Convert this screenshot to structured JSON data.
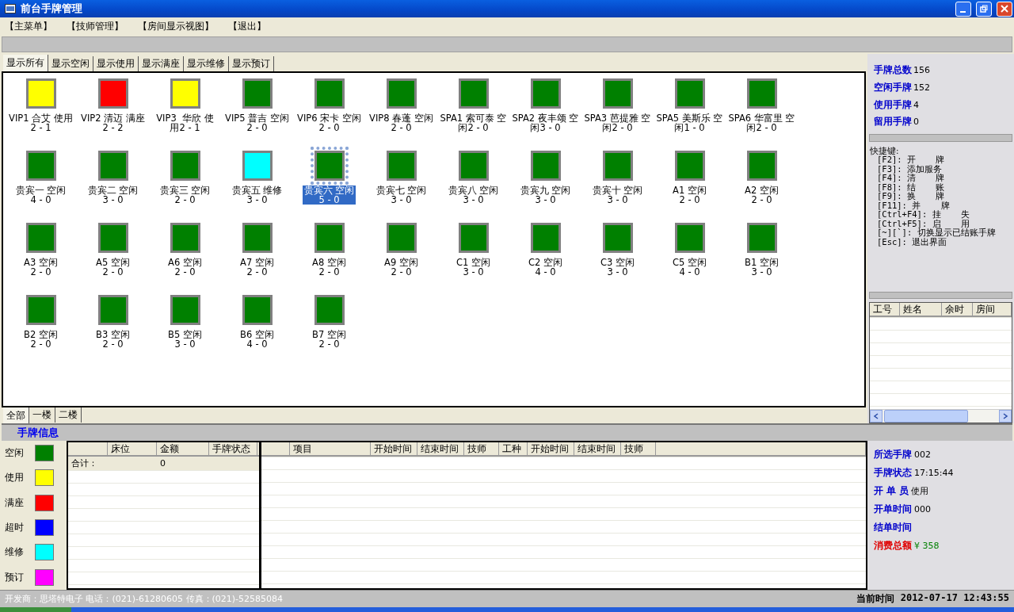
{
  "window": {
    "title": "前台手牌管理"
  },
  "menu": [
    "【主菜单】",
    "【技师管理】",
    "【房间显示视图】",
    "【退出】"
  ],
  "filter_tabs": [
    {
      "label": "显示所有",
      "selected": true
    },
    {
      "label": "显示空闲",
      "selected": false
    },
    {
      "label": "显示使用",
      "selected": false
    },
    {
      "label": "显示满座",
      "selected": false
    },
    {
      "label": "显示维修",
      "selected": false
    },
    {
      "label": "显示预订",
      "selected": false
    }
  ],
  "rooms": [
    {
      "line1": "VIP1 合艾 使用",
      "line2": "2 - 1",
      "color": "#ffff00",
      "selected": false
    },
    {
      "line1": "VIP2 清迈 满座",
      "line2": "2 - 2",
      "color": "#ff0000",
      "selected": false
    },
    {
      "line1": "VIP3  华欣 使",
      "line2": "用2 - 1",
      "color": "#ffff00",
      "selected": false
    },
    {
      "line1": "VIP5 普吉 空闲",
      "line2": "2 - 0",
      "color": "#008000",
      "selected": false
    },
    {
      "line1": "VIP6 宋卡 空闲",
      "line2": "2 - 0",
      "color": "#008000",
      "selected": false
    },
    {
      "line1": "VIP8 春蓬 空闲",
      "line2": "2 - 0",
      "color": "#008000",
      "selected": false
    },
    {
      "line1": "SPA1 索可泰 空",
      "line2": "闲2 - 0",
      "color": "#008000",
      "selected": false
    },
    {
      "line1": "SPA2 夜丰颂 空",
      "line2": "闲3 - 0",
      "color": "#008000",
      "selected": false
    },
    {
      "line1": "SPA3 芭提雅 空",
      "line2": "闲2 - 0",
      "color": "#008000",
      "selected": false
    },
    {
      "line1": "SPA5 美斯乐 空",
      "line2": "闲1 - 0",
      "color": "#008000",
      "selected": false
    },
    {
      "line1": "SPA6 华富里 空",
      "line2": "闲2 - 0",
      "color": "#008000",
      "selected": false
    },
    {
      "line1": "贵宾一 空闲",
      "line2": "4 - 0",
      "color": "#008000",
      "selected": false
    },
    {
      "line1": "贵宾二 空闲",
      "line2": "3 - 0",
      "color": "#008000",
      "selected": false
    },
    {
      "line1": "贵宾三 空闲",
      "line2": "2 - 0",
      "color": "#008000",
      "selected": false
    },
    {
      "line1": "贵宾五 维修",
      "line2": "3 - 0",
      "color": "#00ffff",
      "selected": false
    },
    {
      "line1": "贵宾六 空闲",
      "line2": "5 - 0",
      "color": "#008000",
      "selected": true
    },
    {
      "line1": "贵宾七 空闲",
      "line2": "3 - 0",
      "color": "#008000",
      "selected": false
    },
    {
      "line1": "贵宾八 空闲",
      "line2": "3 - 0",
      "color": "#008000",
      "selected": false
    },
    {
      "line1": "贵宾九 空闲",
      "line2": "3 - 0",
      "color": "#008000",
      "selected": false
    },
    {
      "line1": "贵宾十 空闲",
      "line2": "3 - 0",
      "color": "#008000",
      "selected": false
    },
    {
      "line1": "A1 空闲",
      "line2": "2 - 0",
      "color": "#008000",
      "selected": false
    },
    {
      "line1": "A2 空闲",
      "line2": "2 - 0",
      "color": "#008000",
      "selected": false
    },
    {
      "line1": "A3 空闲",
      "line2": "2 - 0",
      "color": "#008000",
      "selected": false
    },
    {
      "line1": "A5 空闲",
      "line2": "2 - 0",
      "color": "#008000",
      "selected": false
    },
    {
      "line1": "A6 空闲",
      "line2": "2 - 0",
      "color": "#008000",
      "selected": false
    },
    {
      "line1": "A7 空闲",
      "line2": "2 - 0",
      "color": "#008000",
      "selected": false
    },
    {
      "line1": "A8 空闲",
      "line2": "2 - 0",
      "color": "#008000",
      "selected": false
    },
    {
      "line1": "A9 空闲",
      "line2": "2 - 0",
      "color": "#008000",
      "selected": false
    },
    {
      "line1": "C1 空闲",
      "line2": "3 - 0",
      "color": "#008000",
      "selected": false
    },
    {
      "line1": "C2 空闲",
      "line2": "4 - 0",
      "color": "#008000",
      "selected": false
    },
    {
      "line1": "C3 空闲",
      "line2": "3 - 0",
      "color": "#008000",
      "selected": false
    },
    {
      "line1": "C5 空闲",
      "line2": "4 - 0",
      "color": "#008000",
      "selected": false
    },
    {
      "line1": "B1 空闲",
      "line2": "3 - 0",
      "color": "#008000",
      "selected": false
    },
    {
      "line1": "B2 空闲",
      "line2": "2 - 0",
      "color": "#008000",
      "selected": false
    },
    {
      "line1": "B3 空闲",
      "line2": "2 - 0",
      "color": "#008000",
      "selected": false
    },
    {
      "line1": "B5 空闲",
      "line2": "3 - 0",
      "color": "#008000",
      "selected": false
    },
    {
      "line1": "B6 空闲",
      "line2": "4 - 0",
      "color": "#008000",
      "selected": false
    },
    {
      "line1": "B7 空闲",
      "line2": "2 - 0",
      "color": "#008000",
      "selected": false
    }
  ],
  "floor_tabs": [
    {
      "label": "全部",
      "selected": true
    },
    {
      "label": "一楼",
      "selected": false
    },
    {
      "label": "二楼",
      "selected": false
    }
  ],
  "stats": [
    {
      "label": "手牌总数",
      "value": "156"
    },
    {
      "label": "空闲手牌",
      "value": "152"
    },
    {
      "label": "使用手牌",
      "value": "4"
    },
    {
      "label": "留用手牌",
      "value": "0"
    }
  ],
  "shortcuts": {
    "title": "快捷键:",
    "items": [
      "[F2]: 开    牌",
      "[F3]: 添加服务",
      "[F4]: 清    牌",
      "[F8]: 结    账",
      "[F9]: 换    牌",
      "[F11]: 并    牌",
      "[Ctrl+F4]: 挂    失",
      "[Ctrl+F5]: 启    用",
      "[~][`]: 切换显示已结账手牌",
      "[Esc]: 退出界面"
    ]
  },
  "tech_table": {
    "columns": [
      "工号",
      "姓名",
      "余时",
      "房间"
    ]
  },
  "info_header": "手牌信息",
  "legend": [
    {
      "label": "空闲",
      "color": "#008000"
    },
    {
      "label": "使用",
      "color": "#ffff00"
    },
    {
      "label": "满座",
      "color": "#ff0000"
    },
    {
      "label": "超时",
      "color": "#0000ff"
    },
    {
      "label": "维修",
      "color": "#00ffff"
    },
    {
      "label": "预订",
      "color": "#ff00ff"
    }
  ],
  "bed_table": {
    "columns": [
      "",
      "床位",
      "金额",
      "手牌状态"
    ],
    "rows": [
      [
        "合计：",
        "",
        "0",
        ""
      ]
    ]
  },
  "item_table": {
    "columns": [
      "",
      "项目",
      "开始时间",
      "结束时间",
      "技师",
      "工种",
      "开始时间",
      "结束时间",
      "技师"
    ]
  },
  "details": [
    {
      "label": "所选手牌",
      "value": "002",
      "kind": "normal"
    },
    {
      "label": "手牌状态",
      "value": "17:15:44",
      "kind": "normal"
    },
    {
      "label": "开 单 员",
      "value": "使用",
      "kind": "normal"
    },
    {
      "label": "开单时间",
      "value": "000",
      "kind": "normal"
    },
    {
      "label": "结单时间",
      "kind": "normal"
    },
    {
      "label": "消费总额",
      "value": "¥ 358",
      "kind": "total"
    }
  ],
  "status_bar": {
    "developer": "开发商：思塔特电子  电话：(021)-61280605   传真：(021)-52585084",
    "time_label": "当前时间",
    "time": "2012-07-17 12:43:55"
  }
}
